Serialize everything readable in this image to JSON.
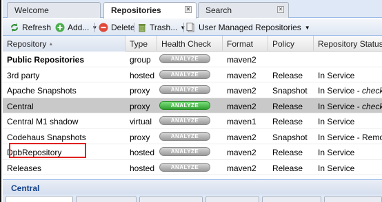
{
  "tabs": [
    {
      "label": "Welcome"
    },
    {
      "label": "Repositories"
    },
    {
      "label": "Search"
    }
  ],
  "toolbar": {
    "refresh": "Refresh",
    "add": "Add...",
    "delete": "Delete",
    "trash": "Trash...",
    "user_managed": "User Managed Repositories"
  },
  "columns": {
    "repository": "Repository",
    "type": "Type",
    "health": "Health Check",
    "format": "Format",
    "policy": "Policy",
    "status": "Repository Status"
  },
  "analyze_label": "ANALYZE",
  "rows": [
    {
      "name": "Public Repositories",
      "type": "group",
      "format": "maven2",
      "policy": "",
      "status": "",
      "status_extra": ""
    },
    {
      "name": "3rd party",
      "type": "hosted",
      "format": "maven2",
      "policy": "Release",
      "status": "In Service",
      "status_extra": ""
    },
    {
      "name": "Apache Snapshots",
      "type": "proxy",
      "format": "maven2",
      "policy": "Snapshot",
      "status": "In Service - ",
      "status_extra": "checking"
    },
    {
      "name": "Central",
      "type": "proxy",
      "format": "maven2",
      "policy": "Release",
      "status": "In Service - ",
      "status_extra": "checking"
    },
    {
      "name": "Central M1 shadow",
      "type": "virtual",
      "format": "maven1",
      "policy": "Release",
      "status": "In Service",
      "status_extra": ""
    },
    {
      "name": "Codehaus Snapshots",
      "type": "proxy",
      "format": "maven2",
      "policy": "Snapshot",
      "status": "In Service - Remote",
      "status_extra": ""
    },
    {
      "name": "DpbRepository",
      "type": "hosted",
      "format": "maven2",
      "policy": "Release",
      "status": "In Service",
      "status_extra": ""
    },
    {
      "name": "Releases",
      "type": "hosted",
      "format": "maven2",
      "policy": "Release",
      "status": "In Service",
      "status_extra": ""
    }
  ],
  "selected_row": "Central",
  "highlighted_row": "DpbRepository",
  "bottom": {
    "title": "Central"
  },
  "colors": {
    "accent": "#15428b",
    "highlight": "#e02020",
    "selected": "#c9c9c9",
    "analyze_active": "#3fae3f"
  }
}
